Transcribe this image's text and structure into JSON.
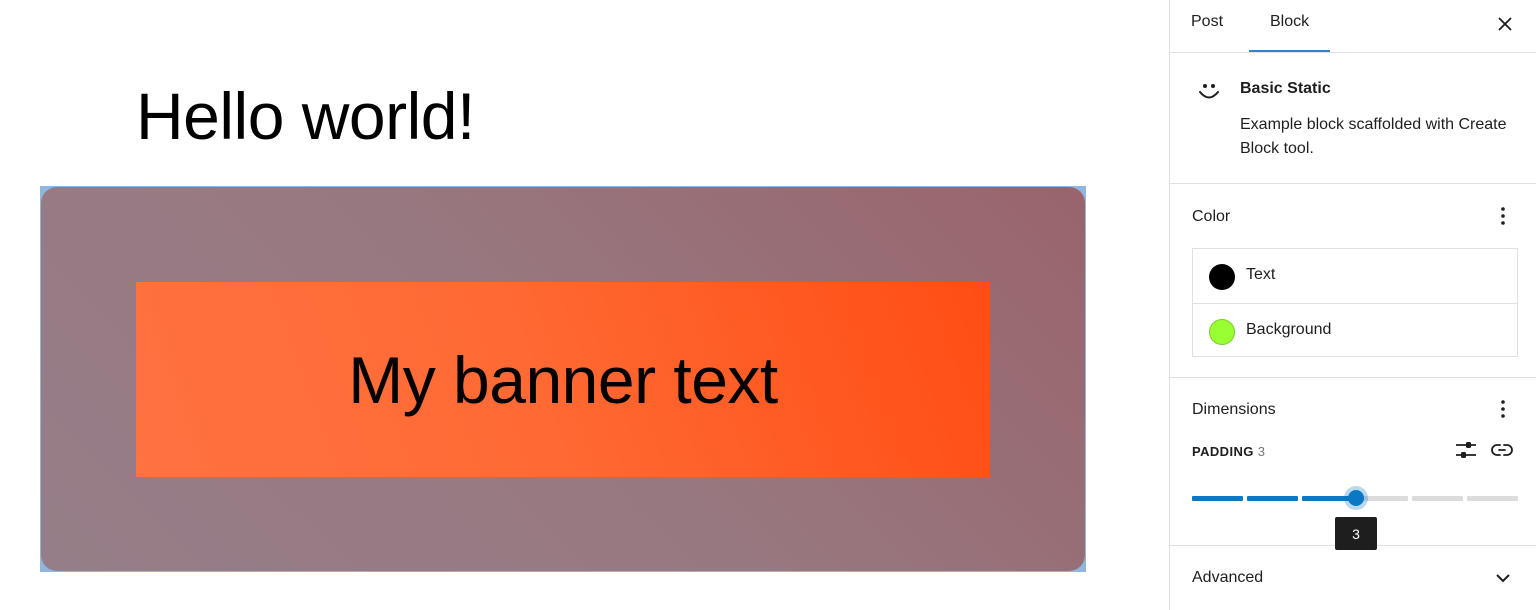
{
  "canvas": {
    "post_title": "Hello world!",
    "banner_text": "My banner text"
  },
  "sidebar": {
    "tabs": [
      {
        "label": "Post",
        "active": false
      },
      {
        "label": "Block",
        "active": true
      }
    ],
    "block": {
      "icon": "smiley-icon",
      "name": "Basic Static",
      "description": "Example block scaffolded with Create Block tool."
    },
    "color": {
      "title": "Color",
      "items": [
        {
          "label": "Text",
          "swatch": "#000000"
        },
        {
          "label": "Background",
          "swatch": "#99ff33"
        }
      ]
    },
    "dimensions": {
      "title": "Dimensions",
      "padding_label": "PADDING",
      "padding_value": "3",
      "slider_value": 3,
      "slider_steps": 6,
      "tooltip": "3"
    },
    "advanced": {
      "title": "Advanced"
    }
  },
  "colors": {
    "accent": "#0a78c2",
    "tab_indicator": "#3a82c4",
    "banner_outer": "#987880",
    "banner_inner": "#ff6a34"
  }
}
